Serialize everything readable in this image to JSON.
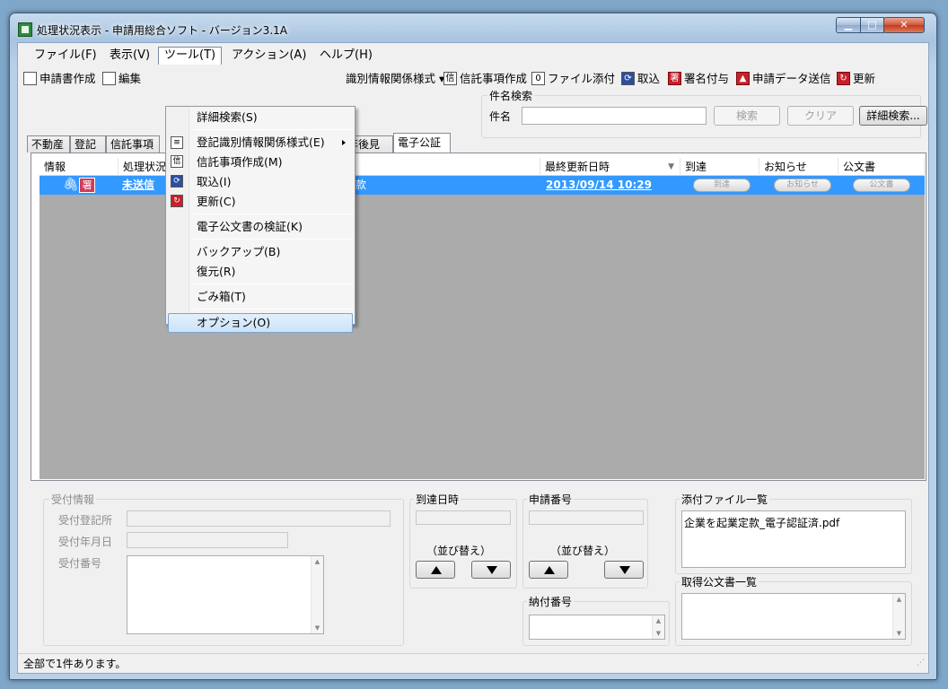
{
  "window": {
    "title": "処理状況表示 - 申請用総合ソフト - バージョン3.1A",
    "minimize": "▁",
    "maximize": "□",
    "close": "✕"
  },
  "menubar": [
    "ファイル(F)",
    "表示(V)",
    "ツール(T)",
    "アクション(A)",
    "ヘルプ(H)"
  ],
  "toolbar": {
    "create": "申請書作成",
    "edit": "編集",
    "registry": "識別情報関係様式",
    "trust": "信託事項作成",
    "attach": "ファイル添付",
    "import": "取込",
    "sign": "署名付与",
    "send": "申請データ送信",
    "refresh": "更新"
  },
  "search": {
    "caption": "件名検索",
    "label": "件名",
    "value": "",
    "search_btn": "検索",
    "clear_btn": "クリア",
    "detail_btn": "詳細検索..."
  },
  "tabs": [
    "不動産",
    "登記",
    "信託事項",
    "年後見",
    "電子公証"
  ],
  "grid": {
    "headers": [
      "情報",
      "処理状況",
      "最終更新日時",
      "到達",
      "お知らせ",
      "公文書"
    ],
    "row": {
      "status": "未送信",
      "subject_tail": "款",
      "updated": "2013/09/14 10:29",
      "arrival_btn": "到達",
      "notice_btn": "お知らせ",
      "doc_btn": "公文書"
    }
  },
  "tools_menu": {
    "items": [
      "詳細検索(S)",
      "登記識別情報関係様式(E)",
      "信託事項作成(M)",
      "取込(I)",
      "更新(C)",
      "電子公文書の検証(K)",
      "バックアップ(B)",
      "復元(R)",
      "ごみ箱(T)",
      "オプション(O)"
    ]
  },
  "details": {
    "reception_caption": "受付情報",
    "reception_office": "受付登記所",
    "reception_date": "受付年月日",
    "reception_number": "受付番号",
    "arrival_caption": "到達日時",
    "application_caption": "申請番号",
    "sort_label_1": "（並び替え）",
    "sort_label_2": "（並び替え）",
    "payment_caption": "納付番号",
    "attachments_caption": "添付ファイル一覧",
    "attachment_file": "企業を起業定款_電子認証済.pdf",
    "acquired_caption": "取得公文書一覧"
  },
  "status": "全部で1件あります。"
}
